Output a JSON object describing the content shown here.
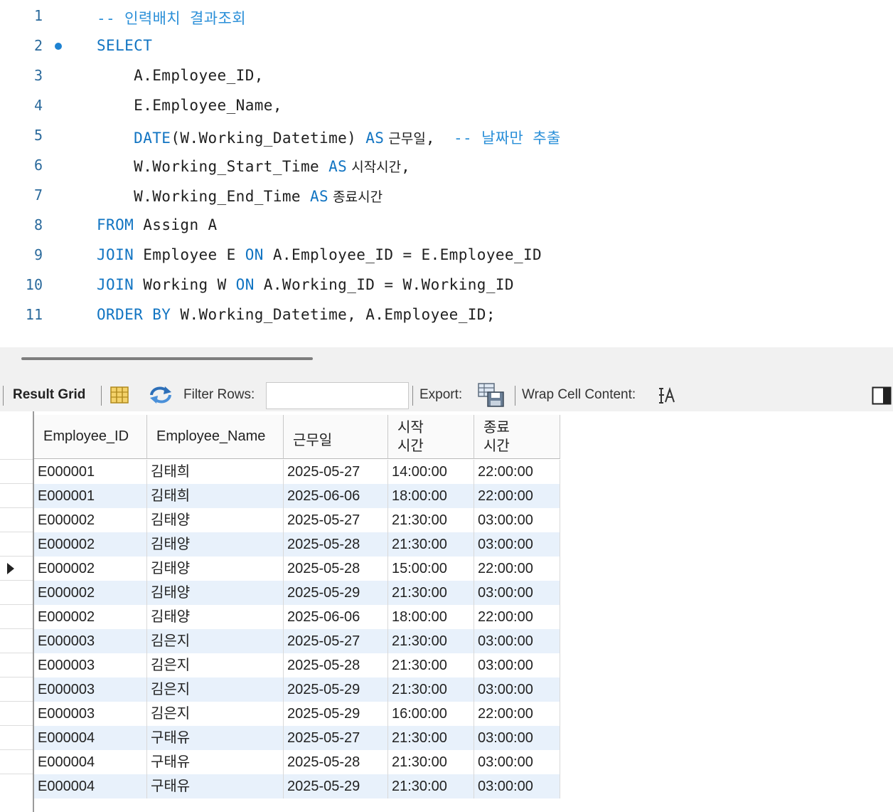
{
  "editor": {
    "lines": [
      {
        "num": "1",
        "segments": [
          {
            "t": "-- 인력배치 결과조회",
            "c": "cm"
          }
        ]
      },
      {
        "num": "2",
        "segments": [
          {
            "t": "SELECT",
            "c": "kw"
          }
        ],
        "marker": true
      },
      {
        "num": "3",
        "segments": [
          {
            "t": "    A.Employee_ID,",
            "c": ""
          }
        ]
      },
      {
        "num": "4",
        "segments": [
          {
            "t": "    E.Employee_Name,",
            "c": ""
          }
        ]
      },
      {
        "num": "5",
        "segments": [
          {
            "t": "    DATE",
            "c": "kw"
          },
          {
            "t": "(W.Working_Datetime) ",
            "c": ""
          },
          {
            "t": "AS",
            "c": "kw"
          },
          {
            "t": " 근무일",
            "c": "ko"
          },
          {
            "t": ",  ",
            "c": ""
          },
          {
            "t": "-- 날짜만 추출",
            "c": "cm"
          }
        ]
      },
      {
        "num": "6",
        "segments": [
          {
            "t": "    W.Working_Start_Time ",
            "c": ""
          },
          {
            "t": "AS",
            "c": "kw"
          },
          {
            "t": " 시작시간",
            "c": "ko"
          },
          {
            "t": ",",
            "c": ""
          }
        ]
      },
      {
        "num": "7",
        "segments": [
          {
            "t": "    W.Working_End_Time ",
            "c": ""
          },
          {
            "t": "AS",
            "c": "kw"
          },
          {
            "t": " 종료시간",
            "c": "ko"
          }
        ]
      },
      {
        "num": "8",
        "segments": [
          {
            "t": "FROM",
            "c": "kw"
          },
          {
            "t": " Assign A",
            "c": ""
          }
        ]
      },
      {
        "num": "9",
        "segments": [
          {
            "t": "JOIN",
            "c": "kw"
          },
          {
            "t": " Employee E ",
            "c": ""
          },
          {
            "t": "ON",
            "c": "kw"
          },
          {
            "t": " A.Employee_ID = E.Employee_ID",
            "c": ""
          }
        ]
      },
      {
        "num": "10",
        "segments": [
          {
            "t": "JOIN",
            "c": "kw"
          },
          {
            "t": " Working W ",
            "c": ""
          },
          {
            "t": "ON",
            "c": "kw"
          },
          {
            "t": " A.Working_ID = W.Working_ID",
            "c": ""
          }
        ]
      },
      {
        "num": "11",
        "segments": [
          {
            "t": "ORDER BY",
            "c": "kw"
          },
          {
            "t": " W.Working_Datetime, A.Employee_ID;",
            "c": ""
          }
        ]
      }
    ]
  },
  "toolbar": {
    "result_grid_label": "Result Grid",
    "filter_rows_label": "Filter Rows:",
    "filter_value": "",
    "export_label": "Export:",
    "wrap_label": "Wrap Cell Content:",
    "icons": [
      "form-editor-icon",
      "refresh-icon",
      "export-icon",
      "wrap-text-icon",
      "panel-toggle-icon"
    ]
  },
  "grid": {
    "columns": [
      "Employee_ID",
      "Employee_Name",
      "근무일",
      "시작\n시간",
      "종료\n시간"
    ],
    "current_row": 4,
    "rows": [
      [
        "E000001",
        "김태희",
        "2025-05-27",
        "14:00:00",
        "22:00:00"
      ],
      [
        "E000001",
        "김태희",
        "2025-06-06",
        "18:00:00",
        "22:00:00"
      ],
      [
        "E000002",
        "김태양",
        "2025-05-27",
        "21:30:00",
        "03:00:00"
      ],
      [
        "E000002",
        "김태양",
        "2025-05-28",
        "21:30:00",
        "03:00:00"
      ],
      [
        "E000002",
        "김태양",
        "2025-05-28",
        "15:00:00",
        "22:00:00"
      ],
      [
        "E000002",
        "김태양",
        "2025-05-29",
        "21:30:00",
        "03:00:00"
      ],
      [
        "E000002",
        "김태양",
        "2025-06-06",
        "18:00:00",
        "22:00:00"
      ],
      [
        "E000003",
        "김은지",
        "2025-05-27",
        "21:30:00",
        "03:00:00"
      ],
      [
        "E000003",
        "김은지",
        "2025-05-28",
        "21:30:00",
        "03:00:00"
      ],
      [
        "E000003",
        "김은지",
        "2025-05-29",
        "21:30:00",
        "03:00:00"
      ],
      [
        "E000003",
        "김은지",
        "2025-05-29",
        "16:00:00",
        "22:00:00"
      ],
      [
        "E000004",
        "구태유",
        "2025-05-27",
        "21:30:00",
        "03:00:00"
      ],
      [
        "E000004",
        "구태유",
        "2025-05-28",
        "21:30:00",
        "03:00:00"
      ],
      [
        "E000004",
        "구태유",
        "2025-05-29",
        "21:30:00",
        "03:00:00"
      ]
    ]
  }
}
